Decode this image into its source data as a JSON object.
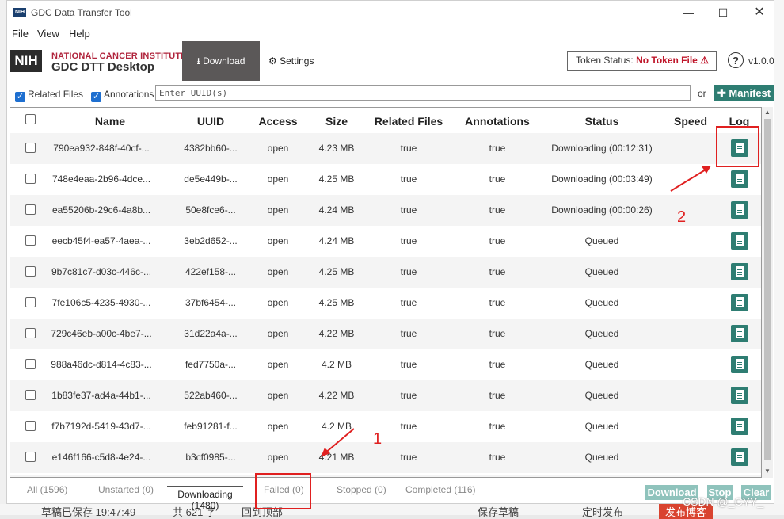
{
  "window": {
    "title": "GDC Data Transfer Tool",
    "app_icon": "NIH"
  },
  "menu": [
    "File",
    "View",
    "Help"
  ],
  "header": {
    "logo_box": "NIH",
    "logo_nci": "NATIONAL CANCER INSTITUTE",
    "logo_name": "GDC DTT Desktop",
    "nav_download": "Download",
    "nav_settings": "Settings",
    "token_label": "Token Status:",
    "token_value": "No Token File",
    "help": "?",
    "version": "v1.0.0"
  },
  "toolbar": {
    "related_files_label": "Related Files",
    "annotations_label": "Annotations",
    "uuid_placeholder": "Enter UUID(s)",
    "or_label": "or",
    "manifest_label": "Manifest"
  },
  "table": {
    "columns": [
      "Name",
      "UUID",
      "Access",
      "Size",
      "Related Files",
      "Annotations",
      "Status",
      "Speed",
      "Log"
    ],
    "rows": [
      {
        "name": "790ea932-848f-40cf-...",
        "uuid": "4382bb60-...",
        "access": "open",
        "size": "4.23 MB",
        "related": "true",
        "annotations": "true",
        "status": "Downloading (00:12:31)",
        "speed": ""
      },
      {
        "name": "748e4eaa-2b96-4dce...",
        "uuid": "de5e449b-...",
        "access": "open",
        "size": "4.25 MB",
        "related": "true",
        "annotations": "true",
        "status": "Downloading (00:03:49)",
        "speed": ""
      },
      {
        "name": "ea55206b-29c6-4a8b...",
        "uuid": "50e8fce6-...",
        "access": "open",
        "size": "4.24 MB",
        "related": "true",
        "annotations": "true",
        "status": "Downloading (00:00:26)",
        "speed": ""
      },
      {
        "name": "eecb45f4-ea57-4aea-...",
        "uuid": "3eb2d652-...",
        "access": "open",
        "size": "4.24 MB",
        "related": "true",
        "annotations": "true",
        "status": "Queued",
        "speed": ""
      },
      {
        "name": "9b7c81c7-d03c-446c-...",
        "uuid": "422ef158-...",
        "access": "open",
        "size": "4.25 MB",
        "related": "true",
        "annotations": "true",
        "status": "Queued",
        "speed": ""
      },
      {
        "name": "7fe106c5-4235-4930-...",
        "uuid": "37bf6454-...",
        "access": "open",
        "size": "4.25 MB",
        "related": "true",
        "annotations": "true",
        "status": "Queued",
        "speed": ""
      },
      {
        "name": "729c46eb-a00c-4be7-...",
        "uuid": "31d22a4a-...",
        "access": "open",
        "size": "4.22 MB",
        "related": "true",
        "annotations": "true",
        "status": "Queued",
        "speed": ""
      },
      {
        "name": "988a46dc-d814-4c83-...",
        "uuid": "fed7750a-...",
        "access": "open",
        "size": "4.2 MB",
        "related": "true",
        "annotations": "true",
        "status": "Queued",
        "speed": ""
      },
      {
        "name": "1b83fe37-ad4a-44b1-...",
        "uuid": "522ab460-...",
        "access": "open",
        "size": "4.22 MB",
        "related": "true",
        "annotations": "true",
        "status": "Queued",
        "speed": ""
      },
      {
        "name": "f7b7192d-5419-43d7-...",
        "uuid": "feb91281-f...",
        "access": "open",
        "size": "4.2 MB",
        "related": "true",
        "annotations": "true",
        "status": "Queued",
        "speed": ""
      },
      {
        "name": "e146f166-c5d8-4e24-...",
        "uuid": "b3cf0985-...",
        "access": "open",
        "size": "4.21 MB",
        "related": "true",
        "annotations": "true",
        "status": "Queued",
        "speed": ""
      }
    ]
  },
  "tabs": {
    "all": "All (1596)",
    "unstarted": "Unstarted (0)",
    "downloading": "Downloading",
    "downloading_count": "(1480)",
    "failed": "Failed (0)",
    "stopped": "Stopped (0)",
    "completed": "Completed (116)"
  },
  "actions": {
    "download": "Download",
    "stop": "Stop",
    "clear": "Clear"
  },
  "annotations": {
    "num1": "1",
    "num2": "2"
  },
  "watermark": "CSDN @_CYY_",
  "background": {
    "bottom_left": "草稿已保存 19:47:49",
    "bottom_words": "共 621 字",
    "bottom_mid": "回到顶部",
    "bottom_btn1": "保存草稿",
    "bottom_btn2": "定时发布",
    "bottom_btn3": "发布博客"
  },
  "colors": {
    "accent": "#2e7d72",
    "nav_active": "#5b5858",
    "token_red": "#c0172b",
    "annotation": "#e02020"
  }
}
